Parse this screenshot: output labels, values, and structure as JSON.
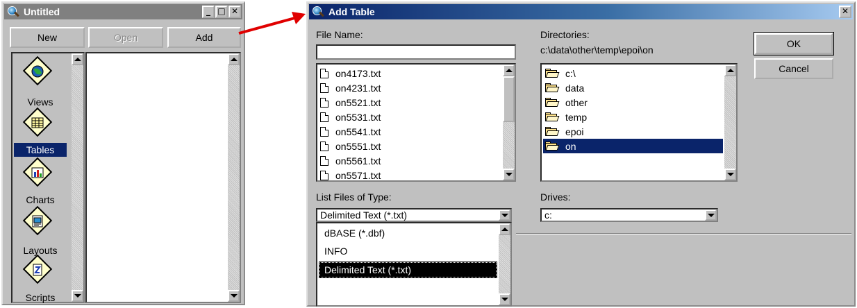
{
  "project_window": {
    "title": "Untitled",
    "buttons": {
      "new": "New",
      "open": "Open",
      "add": "Add"
    },
    "controls": {
      "minimize": "_",
      "maximize": "□",
      "close": "✕"
    },
    "sidebar": [
      {
        "label": "Views",
        "icon": "globe-icon"
      },
      {
        "label": "Tables",
        "icon": "table-icon",
        "selected": true
      },
      {
        "label": "Charts",
        "icon": "bar-chart-icon"
      },
      {
        "label": "Layouts",
        "icon": "layout-icon"
      },
      {
        "label": "Scripts",
        "icon": "script-icon"
      }
    ]
  },
  "dialog": {
    "title": "Add Table",
    "close": "✕",
    "file_name_label": "File Name:",
    "file_name_value": "",
    "files": [
      "on4173.txt",
      "on4231.txt",
      "on5521.txt",
      "on5531.txt",
      "on5541.txt",
      "on5551.txt",
      "on5561.txt",
      "on5571.txt"
    ],
    "directories_label": "Directories:",
    "current_path": "c:\\data\\other\\temp\\epoi\\on",
    "directories": [
      "c:\\",
      "data",
      "other",
      "temp",
      "epoi",
      "on"
    ],
    "selected_directory": "on",
    "ok": "OK",
    "cancel": "Cancel",
    "type_label": "List Files of Type:",
    "type_value": "Delimited Text (*.txt)",
    "type_options": [
      "dBASE (*.dbf)",
      "INFO",
      "Delimited Text (*.txt)"
    ],
    "drives_label": "Drives:",
    "drive_value": "c:"
  },
  "colors": {
    "selection": "#0a246a",
    "arrow": "#e00000",
    "window": "#c0c0c0"
  }
}
